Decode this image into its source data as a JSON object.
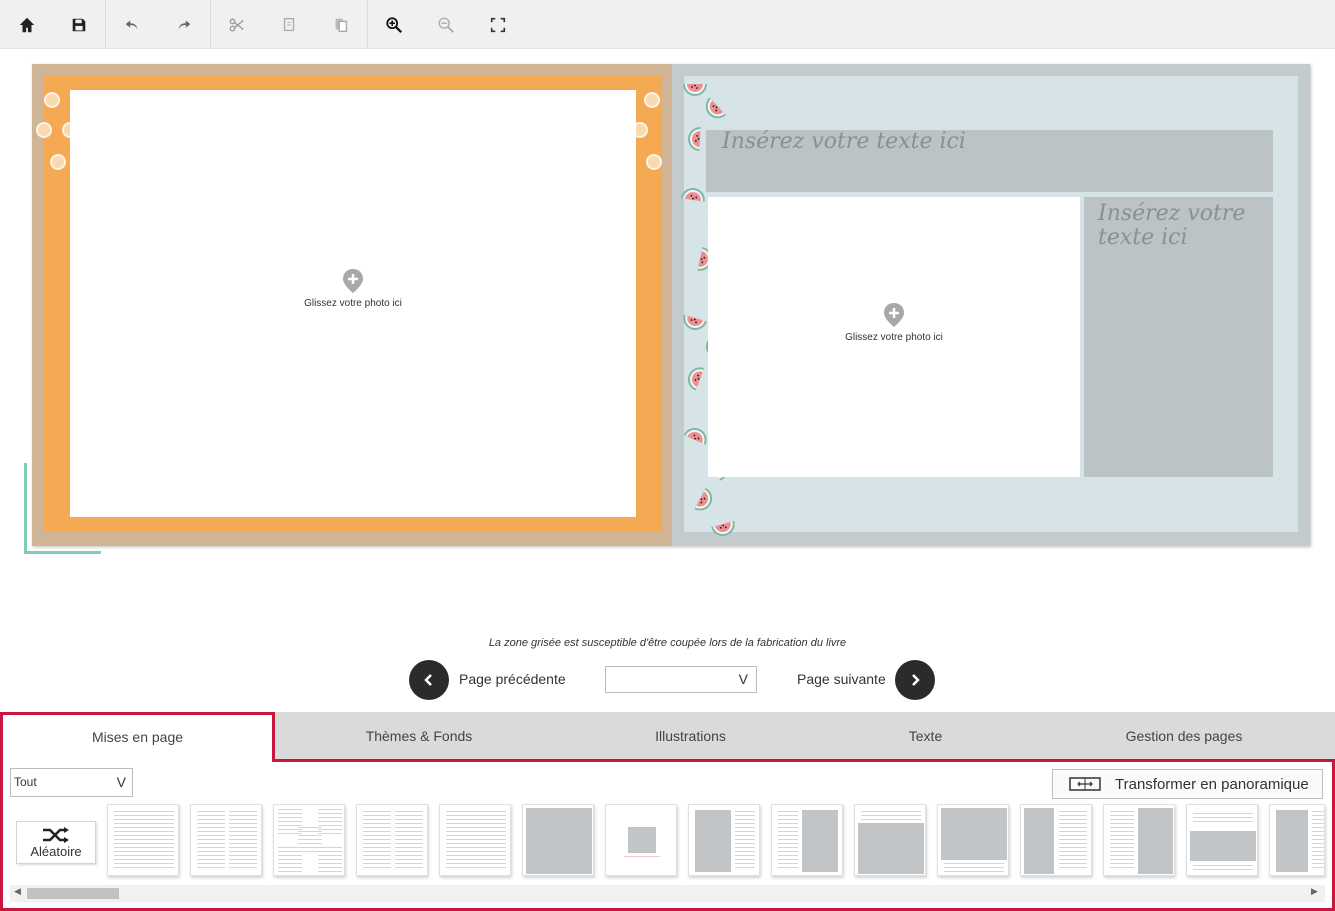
{
  "toolbar": {
    "buttons": [
      "home-icon",
      "save-icon",
      "undo-icon",
      "redo-icon",
      "cut-icon",
      "copy-icon",
      "paste-icon",
      "zoom-in-icon",
      "zoom-out-icon",
      "fullscreen-icon"
    ]
  },
  "spread": {
    "left_photo_hint": "Glissez votre photo ici",
    "right_photo_hint": "Glissez votre photo ici",
    "text_top": "Insérez votre texte ici",
    "text_side": "Insérez votre texte ici"
  },
  "notice": "La zone grisée est susceptible d'être coupée lors de la fabrication du livre",
  "nav": {
    "prev_label": "Page précédente",
    "next_label": "Page suivante",
    "page_select_value": "",
    "select_chevron": "V"
  },
  "tabs": [
    "Mises en page",
    "Thèmes & Fonds",
    "Illustrations",
    "Texte",
    "Gestion des pages"
  ],
  "active_tab": "Mises en page",
  "panel": {
    "filter_value": "Tout",
    "filter_chevron": "V",
    "panorama_label": "Transformer en panoramique",
    "random_label": "Aléatoire"
  },
  "colors": {
    "accent": "#c8163f",
    "left_page_orange": "#f5a952",
    "right_page_blue": "#d6e4e8",
    "text_zone_gray": "#bcc3c4",
    "nav_circle": "#2b2b2b"
  }
}
